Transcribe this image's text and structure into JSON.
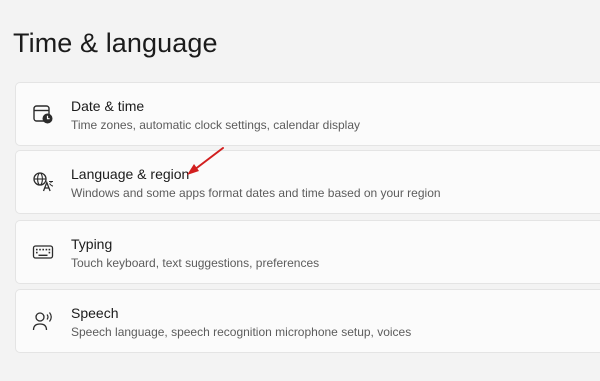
{
  "page": {
    "title": "Time & language"
  },
  "settings": [
    {
      "icon": "calendar-clock-icon",
      "title": "Date & time",
      "subtitle": "Time zones, automatic clock settings, calendar display"
    },
    {
      "icon": "language-icon",
      "title": "Language & region",
      "subtitle": "Windows and some apps format dates and time based on your region"
    },
    {
      "icon": "keyboard-icon",
      "title": "Typing",
      "subtitle": "Touch keyboard, text suggestions, preferences"
    },
    {
      "icon": "speech-icon",
      "title": "Speech",
      "subtitle": "Speech language, speech recognition microphone setup, voices"
    }
  ],
  "annotation": {
    "icon": "red-arrow-icon",
    "color": "#d21f1f"
  }
}
